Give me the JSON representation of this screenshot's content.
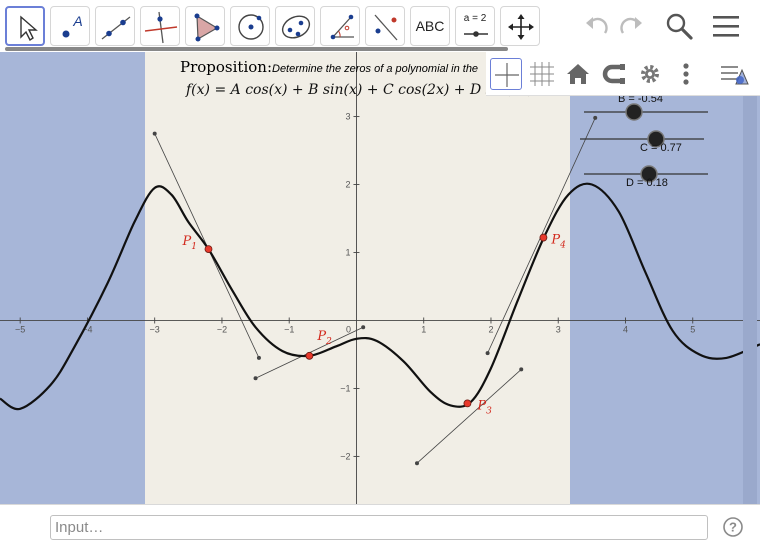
{
  "toolbar": {
    "tools": [
      {
        "name": "move-tool",
        "icon": "cursor-arrow-icon"
      },
      {
        "name": "point-tool",
        "icon": "point-icon",
        "label": "A"
      },
      {
        "name": "line-tool",
        "icon": "line-through-points-icon"
      },
      {
        "name": "perpendicular-line-tool",
        "icon": "perpendicular-line-icon"
      },
      {
        "name": "polygon-tool",
        "icon": "polygon-icon"
      },
      {
        "name": "circle-tool",
        "icon": "circle-center-point-icon"
      },
      {
        "name": "conic-tool",
        "icon": "ellipse-icon"
      },
      {
        "name": "angle-tool",
        "icon": "angle-icon"
      },
      {
        "name": "reflect-tool",
        "icon": "reflect-line-icon"
      },
      {
        "name": "text-tool",
        "icon": "text-icon",
        "label": "ABC"
      },
      {
        "name": "slider-tool",
        "icon": "slider-icon",
        "label": "a = 2"
      },
      {
        "name": "move-view-tool",
        "icon": "move-arrows-icon"
      }
    ],
    "selected_tool": "move-tool",
    "undo_icon": "undo-icon",
    "redo_icon": "redo-icon",
    "search_icon": "search-icon",
    "menu_icon": "hamburger-menu-icon"
  },
  "stylebar": {
    "buttons": [
      {
        "name": "axes-toggle",
        "icon": "axes-icon",
        "active": true
      },
      {
        "name": "grid-toggle",
        "icon": "grid-icon",
        "active": false
      },
      {
        "name": "standard-view-button",
        "icon": "home-icon"
      },
      {
        "name": "point-capturing-button",
        "icon": "magnet-capture-icon"
      },
      {
        "name": "graphics-settings-button",
        "icon": "gear-icon"
      },
      {
        "name": "more-options-button",
        "icon": "more-vertical-icon"
      },
      {
        "name": "toggle-style-bar-button",
        "icon": "style-bar-toggle-icon"
      }
    ]
  },
  "text": {
    "proposition_title": "Proposition:",
    "proposition_text": "Determine the zeros of a polynomial in the",
    "formula": "f(x) = A cos(x) + B sin(x) + C cos(2x) + D sin(2x)"
  },
  "sliders": [
    {
      "name": "B",
      "label": "B = -0.54",
      "value": -0.54
    },
    {
      "name": "C",
      "label": "C = 0.77",
      "value": 0.77
    },
    {
      "name": "D",
      "label": "D = 0.18",
      "value": 0.18
    }
  ],
  "chart_data": {
    "type": "line",
    "function": "f(x) = A cos(x) + B sin(x) + C cos(2x) + D sin(2x)",
    "parameters": {
      "B": -0.54,
      "C": 0.77,
      "D": 0.18
    },
    "x_ticks": [
      -5,
      -4,
      -3,
      -2,
      -1,
      0,
      1,
      2,
      3,
      4,
      5
    ],
    "y_ticks": [
      -2,
      -1,
      0,
      1,
      2,
      3
    ],
    "xlim": [
      -5.3,
      6.0
    ],
    "ylim": [
      -2.7,
      3.95
    ],
    "grid": false,
    "curve_samples": [
      {
        "x": -5.3,
        "y": -1.15
      },
      {
        "x": -5.0,
        "y": -1.3
      },
      {
        "x": -4.55,
        "y": -0.95
      },
      {
        "x": -4.2,
        "y": -0.4
      },
      {
        "x": -3.7,
        "y": 0.55
      },
      {
        "x": -3.3,
        "y": 1.45
      },
      {
        "x": -3.0,
        "y": 1.95
      },
      {
        "x": -2.75,
        "y": 1.85
      },
      {
        "x": -2.5,
        "y": 1.45
      },
      {
        "x": -2.2,
        "y": 1.05
      },
      {
        "x": -1.85,
        "y": 0.45
      },
      {
        "x": -1.5,
        "y": -0.1
      },
      {
        "x": -1.1,
        "y": -0.45
      },
      {
        "x": -0.7,
        "y": -0.52
      },
      {
        "x": -0.3,
        "y": -0.38
      },
      {
        "x": 0.0,
        "y": -0.27
      },
      {
        "x": 0.3,
        "y": -0.3
      },
      {
        "x": 0.7,
        "y": -0.6
      },
      {
        "x": 1.1,
        "y": -1.05
      },
      {
        "x": 1.4,
        "y": -1.25
      },
      {
        "x": 1.7,
        "y": -1.2
      },
      {
        "x": 2.0,
        "y": -0.7
      },
      {
        "x": 2.4,
        "y": 0.3
      },
      {
        "x": 2.8,
        "y": 1.25
      },
      {
        "x": 3.15,
        "y": 1.85
      },
      {
        "x": 3.5,
        "y": 2.0
      },
      {
        "x": 3.9,
        "y": 1.6
      },
      {
        "x": 4.3,
        "y": 0.7
      },
      {
        "x": 4.7,
        "y": -0.15
      },
      {
        "x": 5.1,
        "y": -0.5
      },
      {
        "x": 5.5,
        "y": -0.55
      },
      {
        "x": 6.0,
        "y": -0.35
      }
    ],
    "points": [
      {
        "label": "P",
        "sub": "1",
        "x": -2.2,
        "y": 1.05
      },
      {
        "label": "P",
        "sub": "2",
        "x": -0.7,
        "y": -0.52
      },
      {
        "label": "P",
        "sub": "3",
        "x": 1.65,
        "y": -1.22
      },
      {
        "label": "P",
        "sub": "4",
        "x": 2.78,
        "y": 1.22
      }
    ],
    "tangent_segments": [
      {
        "x1": -3.0,
        "y1": 2.75,
        "x2": -1.45,
        "y2": -0.55
      },
      {
        "x1": -1.5,
        "y1": -0.85,
        "x2": 0.1,
        "y2": -0.1
      },
      {
        "x1": 0.9,
        "y1": -2.1,
        "x2": 2.45,
        "y2": -0.72
      },
      {
        "x1": 1.95,
        "y1": -0.48,
        "x2": 3.55,
        "y2": 2.98
      }
    ]
  },
  "input_bar": {
    "placeholder": "Input…",
    "help_icon": "help-icon"
  }
}
